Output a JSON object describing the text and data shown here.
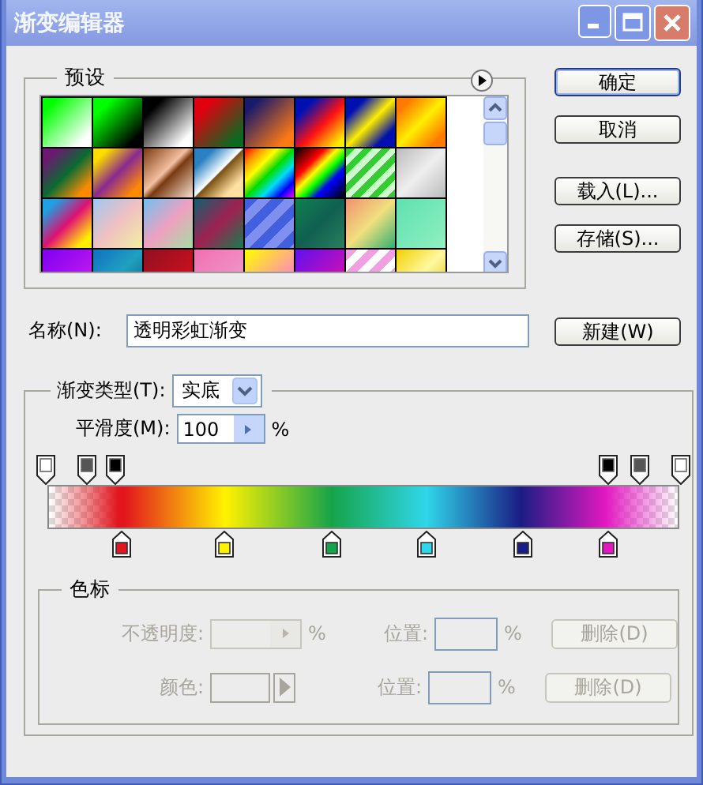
{
  "window": {
    "title": "渐变编辑器"
  },
  "presets": {
    "title": "预设"
  },
  "buttons": [
    {
      "label": "确定",
      "default": true
    },
    {
      "label": "取消",
      "default": false
    },
    {
      "label": "载入(L)...",
      "default": false
    },
    {
      "label": "存储(S)...",
      "default": false
    }
  ],
  "name_field": {
    "label": "名称(N):",
    "value": "透明彩虹渐变"
  },
  "new_button": {
    "label": "新建(W)"
  },
  "gradient": {
    "type_label": "渐变类型(T):",
    "type_value": "实底",
    "smoothness_label": "平滑度(M):",
    "smoothness_value": "100",
    "smoothness_unit": "%",
    "opacity_stops": [
      {
        "kind": "clear"
      },
      {
        "kind": "partial"
      },
      {
        "kind": "solid"
      },
      {
        "kind": "solid"
      },
      {
        "kind": "partial"
      },
      {
        "kind": "clear"
      }
    ],
    "color_stops": [
      {
        "color": "#e2161e"
      },
      {
        "color": "#fff200"
      },
      {
        "color": "#16a44a"
      },
      {
        "color": "#30d6ea"
      },
      {
        "color": "#1a1d84"
      },
      {
        "color": "#e218c0"
      }
    ]
  },
  "stop_settings": {
    "title": "色标",
    "disabled": true,
    "rows": [
      {
        "kind": "opacity",
        "label": "不透明度:",
        "unit": "%",
        "position_label": "位置:",
        "position_unit": "%",
        "delete_button": "删除(D)"
      },
      {
        "kind": "color",
        "label": "颜色:",
        "position_label": "位置:",
        "position_unit": "%",
        "delete_button": "删除(D)"
      }
    ]
  }
}
